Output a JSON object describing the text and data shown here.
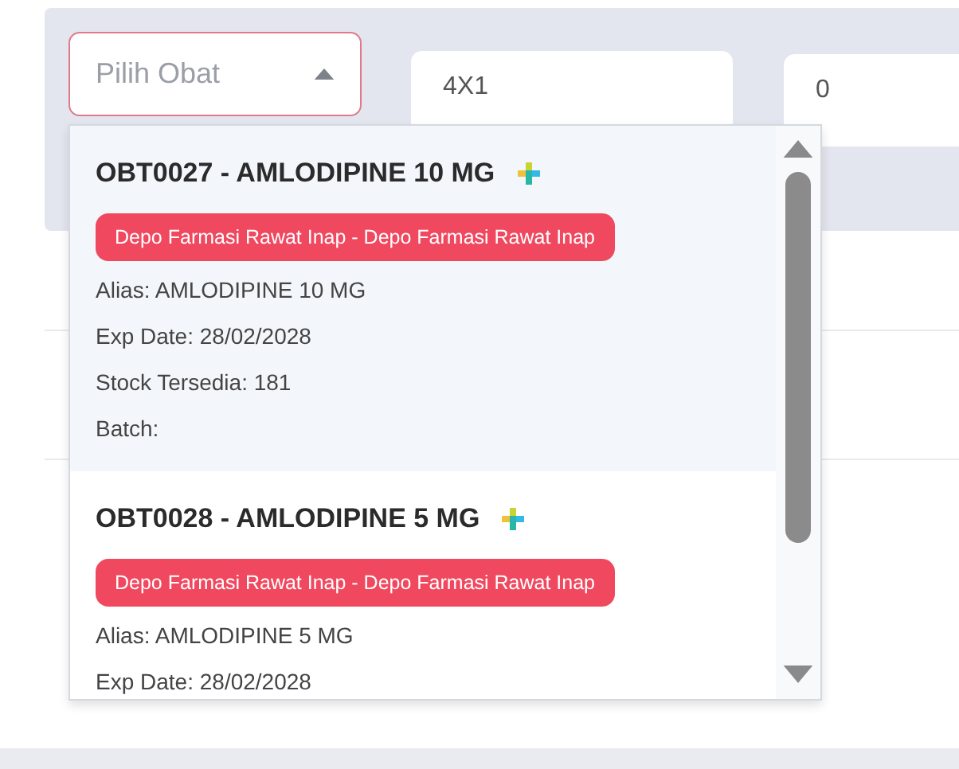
{
  "medicine_select": {
    "placeholder": "Pilih Obat",
    "expanded": true
  },
  "fields": [
    {
      "value": "4X1"
    },
    {
      "value": "0"
    }
  ],
  "options": [
    {
      "title": "OBT0027 - AMLODIPINE 10 MG",
      "depot": "Depo Farmasi Rawat Inap - Depo Farmasi Rawat Inap",
      "details": [
        "Alias: AMLODIPINE 10 MG",
        "Exp Date: 28/02/2028",
        "Stock Tersedia: 181",
        "Batch:"
      ],
      "selected": true
    },
    {
      "title": "OBT0028 - AMLODIPINE 5 MG",
      "depot": "Depo Farmasi Rawat Inap - Depo Farmasi Rawat Inap",
      "details": [
        "Alias: AMLODIPINE 5 MG",
        "Exp Date: 28/02/2028"
      ],
      "selected": false
    }
  ]
}
